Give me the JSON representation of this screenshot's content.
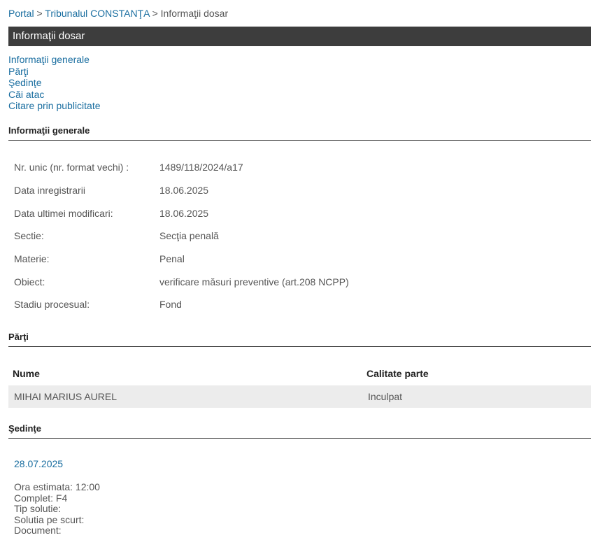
{
  "breadcrumb": {
    "items": [
      "Portal",
      "Tribunalul CONSTANŢA",
      "Informaţii dosar"
    ],
    "separator": ">"
  },
  "page_title": "Informaţii dosar",
  "anchors": [
    "Informaţii generale",
    "Părţi",
    "Şedinţe",
    "Căi atac",
    "Citare prin publicitate"
  ],
  "info": {
    "heading": "Informaţii generale",
    "rows": [
      {
        "label": "Nr. unic (nr. format vechi) :",
        "value": "1489/118/2024/a17"
      },
      {
        "label": "Data inregistrarii",
        "value": "18.06.2025"
      },
      {
        "label": "Data ultimei modificari:",
        "value": "18.06.2025"
      },
      {
        "label": "Sectie:",
        "value": "Secţia penală"
      },
      {
        "label": "Materie:",
        "value": "Penal"
      },
      {
        "label": "Obiect:",
        "value": "verificare măsuri preventive (art.208 NCPP)"
      },
      {
        "label": "Stadiu procesual:",
        "value": "Fond"
      }
    ]
  },
  "parti": {
    "heading": "Părţi",
    "columns": [
      "Nume",
      "Calitate parte"
    ],
    "rows": [
      {
        "nume": "MIHAI MARIUS AUREL",
        "calitate": "Inculpat"
      }
    ]
  },
  "sedinte": {
    "heading": "Şedinţe",
    "date": "28.07.2025",
    "details": [
      "Ora estimata: 12:00",
      "Complet: F4",
      "Tip solutie:",
      "Solutia pe scurt:",
      "Document:"
    ]
  },
  "colors": {
    "link": "#1a6ea0",
    "title_bar": "#3d3d3d",
    "row_highlight": "#ececec"
  }
}
